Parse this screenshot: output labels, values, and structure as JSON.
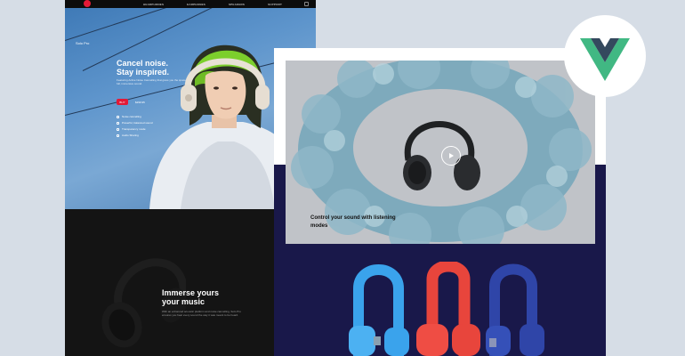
{
  "nav": {
    "links": [
      "HEADPHONES",
      "EARPHONES",
      "SPEAKERS",
      "SUPPORT"
    ]
  },
  "hero": {
    "model": "Solo Pro",
    "headline": "Cancel noise.\nStay inspired.",
    "blurb": "Featuring Active Noise Cancelling that gives you the space to create with full, immersive sound.",
    "buy_label": "BUY",
    "price": "$299.95",
    "features": [
      "Noise cancelling",
      "Powerful, balanced sound",
      "Transparency mode",
      "Audio Sharing"
    ]
  },
  "dark_section": {
    "title": "Immerse yours\nyour music",
    "body": "With an enhanced acoustic platform and noise cancelling, Solo Pro ensures you hear every sound the way it was meant to be heard."
  },
  "video": {
    "caption": "Control your sound with listening modes"
  },
  "colors": {
    "accent": "#e31937",
    "navy": "#19184a",
    "vue_green": "#41b883",
    "vue_dark": "#34495e"
  }
}
